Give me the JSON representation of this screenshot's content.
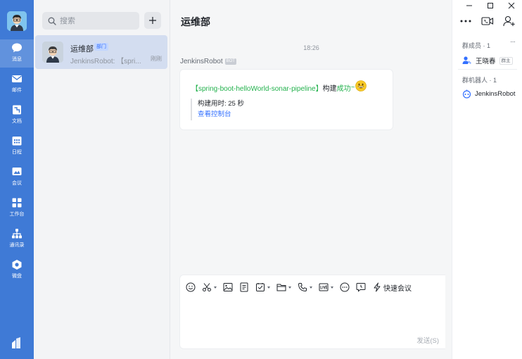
{
  "nav": {
    "items": [
      {
        "label": "消息",
        "icon": "message-icon"
      },
      {
        "label": "邮件",
        "icon": "mail-icon"
      },
      {
        "label": "文档",
        "icon": "doc-icon"
      },
      {
        "label": "日程",
        "icon": "calendar-icon"
      },
      {
        "label": "会议",
        "icon": "meeting-icon"
      },
      {
        "label": "工作台",
        "icon": "workbench-icon"
      },
      {
        "label": "通讯录",
        "icon": "contacts-icon"
      },
      {
        "label": "微盘",
        "icon": "drive-icon"
      }
    ]
  },
  "search": {
    "placeholder": "搜索"
  },
  "conversation": {
    "title": "运维部",
    "tag": "部门",
    "preview": "JenkinsRobot: 【spri...",
    "time": "刚刚"
  },
  "chat": {
    "title": "运维部",
    "time_separator": "18:26",
    "sender": "JenkinsRobot",
    "sender_tag": "BOT",
    "card": {
      "project_part": "【spring-boot-helloWorld-sonar-pipeline】",
      "build_text": "构建",
      "status": "成功",
      "tilde": "~",
      "duration": "构建用时: 25 秒",
      "console_link": "查看控制台"
    }
  },
  "composer": {
    "quick_meeting": "快速会议",
    "send": "发送(S)"
  },
  "members_panel": {
    "members_title": "群成员 · 1",
    "members": [
      {
        "name": "王晓春",
        "tag": "群主"
      }
    ],
    "robots_title": "群机器人 · 1",
    "robots": [
      {
        "name": "JenkinsRobot"
      }
    ],
    "more": "···"
  },
  "colors": {
    "nav_bg": "#3f7ad6",
    "accent": "#3370ff",
    "success": "#22b14c"
  }
}
